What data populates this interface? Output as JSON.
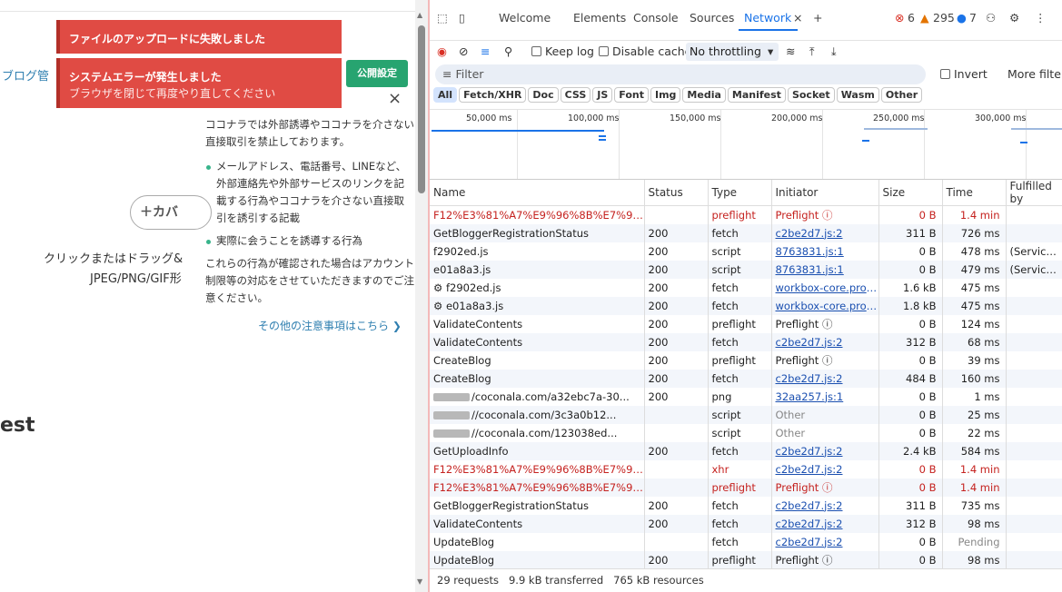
{
  "left": {
    "toast1": "ファイルのアップロードに失敗しました",
    "toast2_title": "システムエラーが発生しました",
    "toast2_sub": "ブラウザを閉じて再度やり直してください",
    "blog_admin": "ブログ管",
    "publish_btn": "公開設定",
    "close": "×",
    "notice_intro": "ココナラでは外部誘導やココナラを介さない直接取引を禁止しております。",
    "notice_item1": "メールアドレス、電話番号、LINEなど、外部連絡先や外部サービスのリンクを記載する行為やココナラを介さない直接取引を誘引する記載",
    "notice_item2": "実際に会うことを誘導する行為",
    "notice_outro": "これらの行為が確認された場合はアカウント制限等の対応をさせていただきますのでご注意ください。",
    "notice_more": "その他の注意事項はこちら ❯",
    "cover_btn": "＋カバ",
    "drag_text": "クリックまたはドラッグ&",
    "format_text": "JPEG/PNG/GIF形",
    "est": "est"
  },
  "devtools": {
    "tabs": {
      "welcome": "Welcome",
      "elements": "Elements",
      "console": "Console",
      "sources": "Sources",
      "network": "Network",
      "close": "×",
      "add": "+"
    },
    "badges": {
      "errors": "6",
      "warnings": "295",
      "info": "7"
    },
    "toolbar": {
      "keep_log": "Keep log",
      "disable_cache": "Disable cache",
      "throttling": "No throttling"
    },
    "filter": {
      "placeholder": "Filter",
      "invert": "Invert",
      "more_filters": "More filters"
    },
    "chips": [
      "All",
      "Fetch/XHR",
      "Doc",
      "CSS",
      "JS",
      "Font",
      "Img",
      "Media",
      "Manifest",
      "Socket",
      "Wasm",
      "Other"
    ],
    "ticks": [
      "50,000 ms",
      "100,000 ms",
      "150,000 ms",
      "200,000 ms",
      "250,000 ms",
      "300,000 ms"
    ],
    "columns": [
      "Name",
      "Status",
      "Type",
      "Initiator",
      "Size",
      "Time",
      "Fulfilled by"
    ],
    "rows": [
      {
        "name": "F12%E3%81%A7%E9%96%8B%E7%99%...",
        "status": "",
        "type": "preflight",
        "initiator": "Preflight ⓘ",
        "size": "0 B",
        "time": "1.4 min",
        "fulfilled": "",
        "err": true
      },
      {
        "name": "GetBloggerRegistrationStatus",
        "status": "200",
        "type": "fetch",
        "initiator": "c2be2d7.js:2",
        "size": "311 B",
        "time": "726 ms",
        "fulfilled": ""
      },
      {
        "name": "f2902ed.js",
        "status": "200",
        "type": "script",
        "initiator": "8763831.js:1",
        "size": "0 B",
        "time": "478 ms",
        "fulfilled": "(ServiceW..."
      },
      {
        "name": "e01a8a3.js",
        "status": "200",
        "type": "script",
        "initiator": "8763831.js:1",
        "size": "0 B",
        "time": "479 ms",
        "fulfilled": "(ServiceW..."
      },
      {
        "name": "⚙ f2902ed.js",
        "status": "200",
        "type": "fetch",
        "initiator": "workbox-core.prod.js:1",
        "size": "1.6 kB",
        "time": "475 ms",
        "fulfilled": ""
      },
      {
        "name": "⚙ e01a8a3.js",
        "status": "200",
        "type": "fetch",
        "initiator": "workbox-core.prod.js:1",
        "size": "1.8 kB",
        "time": "475 ms",
        "fulfilled": ""
      },
      {
        "name": "ValidateContents",
        "status": "200",
        "type": "preflight",
        "initiator": "Preflight ⓘ",
        "size": "0 B",
        "time": "124 ms",
        "fulfilled": ""
      },
      {
        "name": "ValidateContents",
        "status": "200",
        "type": "fetch",
        "initiator": "c2be2d7.js:2",
        "size": "312 B",
        "time": "68 ms",
        "fulfilled": ""
      },
      {
        "name": "CreateBlog",
        "status": "200",
        "type": "preflight",
        "initiator": "Preflight ⓘ",
        "size": "0 B",
        "time": "39 ms",
        "fulfilled": ""
      },
      {
        "name": "CreateBlog",
        "status": "200",
        "type": "fetch",
        "initiator": "c2be2d7.js:2",
        "size": "484 B",
        "time": "160 ms",
        "fulfilled": ""
      },
      {
        "name": "/coconala.com/a32ebc7a-30...",
        "status": "200",
        "type": "png",
        "initiator": "32aa257.js:1",
        "size": "0 B",
        "time": "1 ms",
        "fulfilled": "",
        "blur": true
      },
      {
        "name": "//coconala.com/3c3a0b12...",
        "status": "",
        "type": "script",
        "initiator": "Other",
        "size": "0 B",
        "time": "25 ms",
        "fulfilled": "",
        "blur": true,
        "gray": true
      },
      {
        "name": "//coconala.com/123038ed...",
        "status": "",
        "type": "script",
        "initiator": "Other",
        "size": "0 B",
        "time": "22 ms",
        "fulfilled": "",
        "blur": true,
        "gray": true
      },
      {
        "name": "GetUploadInfo",
        "status": "200",
        "type": "fetch",
        "initiator": "c2be2d7.js:2",
        "size": "2.4 kB",
        "time": "584 ms",
        "fulfilled": ""
      },
      {
        "name": "F12%E3%81%A7%E9%96%8B%E7%99%...",
        "status": "",
        "type": "xhr",
        "initiator": "c2be2d7.js:2",
        "size": "0 B",
        "time": "1.4 min",
        "fulfilled": "",
        "err": true
      },
      {
        "name": "F12%E3%81%A7%E9%96%8B%E7%99%...",
        "status": "",
        "type": "preflight",
        "initiator": "Preflight ⓘ",
        "size": "0 B",
        "time": "1.4 min",
        "fulfilled": "",
        "err": true
      },
      {
        "name": "GetBloggerRegistrationStatus",
        "status": "200",
        "type": "fetch",
        "initiator": "c2be2d7.js:2",
        "size": "311 B",
        "time": "735 ms",
        "fulfilled": ""
      },
      {
        "name": "ValidateContents",
        "status": "200",
        "type": "fetch",
        "initiator": "c2be2d7.js:2",
        "size": "312 B",
        "time": "98 ms",
        "fulfilled": ""
      },
      {
        "name": "UpdateBlog",
        "status": "",
        "type": "fetch",
        "initiator": "c2be2d7.js:2",
        "size": "0 B",
        "time": "Pending",
        "fulfilled": "",
        "pending": true
      },
      {
        "name": "UpdateBlog",
        "status": "200",
        "type": "preflight",
        "initiator": "Preflight ⓘ",
        "size": "0 B",
        "time": "98 ms",
        "fulfilled": ""
      }
    ],
    "status": {
      "requests": "29 requests",
      "transferred": "9.9 kB transferred",
      "resources": "765 kB resources"
    }
  }
}
